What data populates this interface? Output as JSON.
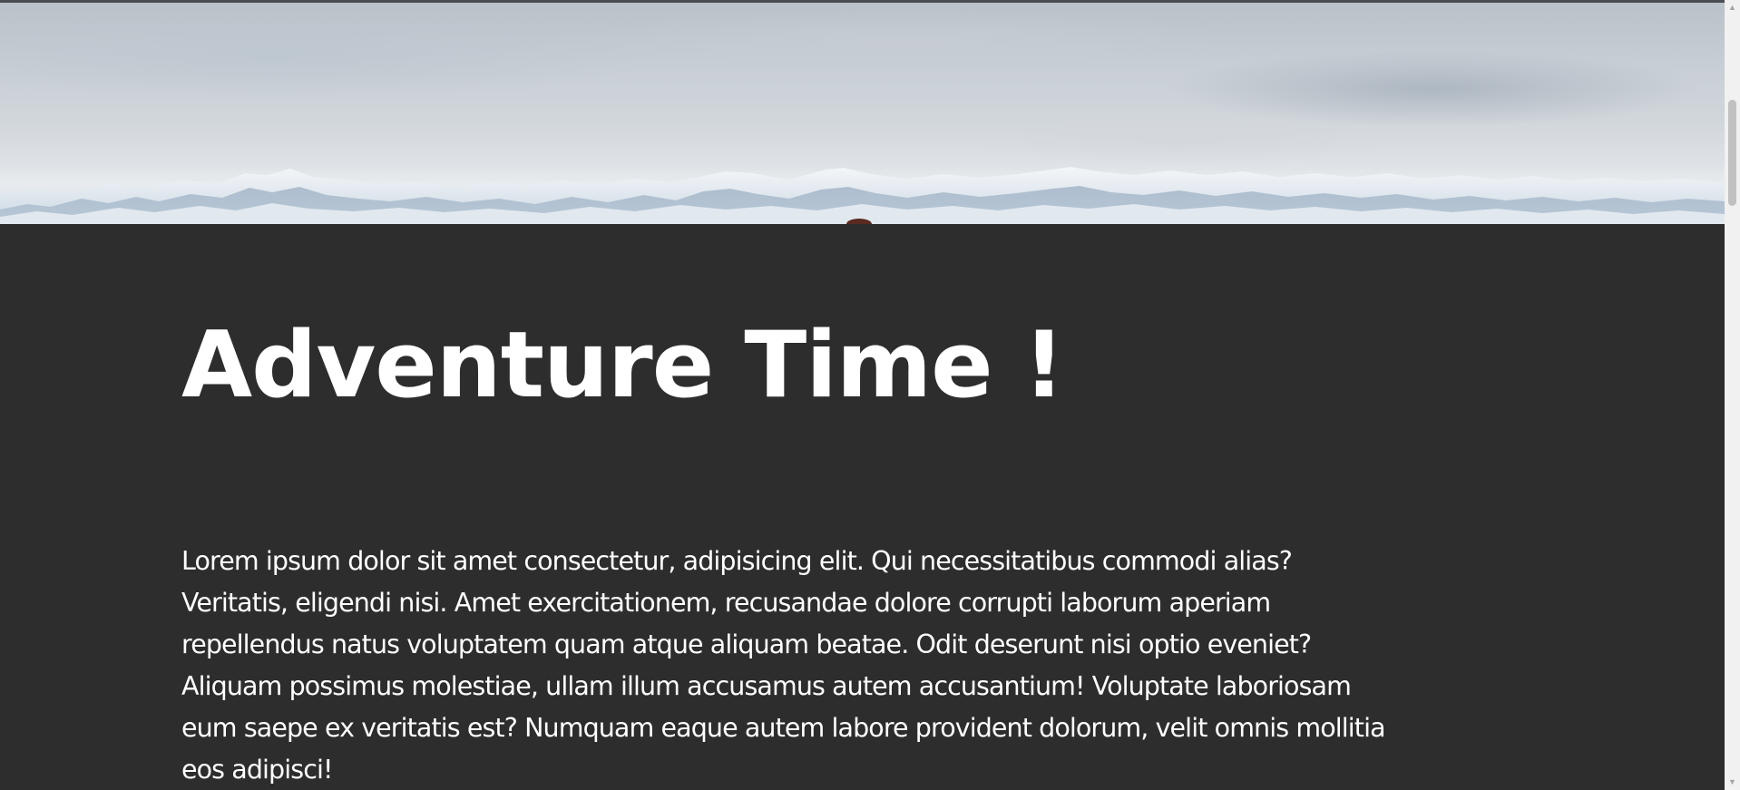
{
  "hero": {
    "image_name": "snowy-mountains-hero-image"
  },
  "main": {
    "title": "Adventure Time !",
    "paragraph_lines": [
      "Lorem ipsum dolor sit amet consectetur, adipisicing elit. Qui necessitatibus commodi alias?",
      "Veritatis, eligendi nisi. Amet exercitationem, recusandae dolore corrupti laborum aperiam",
      "repellendus natus voluptatem quam atque aliquam beatae. Odit deserunt nisi optio eveniet?",
      "Aliquam possimus molestiae, ullam illum accusamus autem accusantium! Voluptate laboriosam",
      "eum saepe ex veritatis est? Numquam eaque autem labore provident dolorum, velit omnis mollitia",
      "eos adipisci!"
    ]
  },
  "scrollbar": {
    "up_icon": "triangle-up-icon",
    "down_icon": "triangle-down-icon",
    "scroll_position": 0.12
  },
  "colors": {
    "background": "#2d2d2d",
    "text": "#ffffff",
    "scrollbar_track": "#f1f1f1",
    "scrollbar_thumb": "#c1c1c1"
  }
}
